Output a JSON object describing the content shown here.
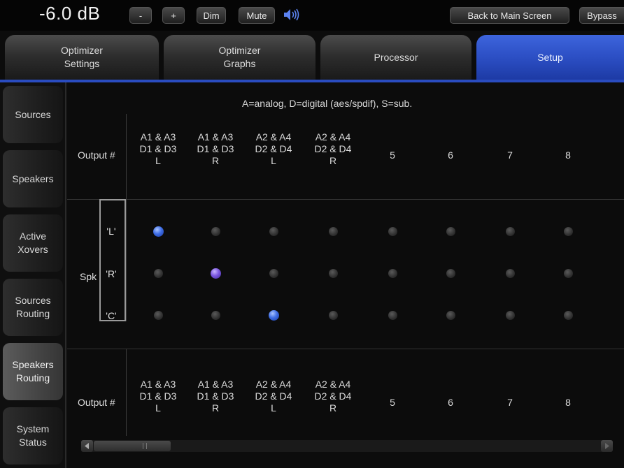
{
  "topbar": {
    "volume": "-6.0 dB",
    "minus_label": "-",
    "plus_label": "+",
    "dim_label": "Dim",
    "mute_label": "Mute",
    "back_label": "Back to Main Screen",
    "bypass_label": "Bypass"
  },
  "tabs": [
    {
      "label": "Optimizer\nSettings"
    },
    {
      "label": "Optimizer\nGraphs"
    },
    {
      "label": "Processor"
    },
    {
      "label": "Setup",
      "active": true
    }
  ],
  "sidebar": [
    {
      "label": "Sources"
    },
    {
      "label": "Speakers"
    },
    {
      "label": "Active\nXovers"
    },
    {
      "label": "Sources\nRouting"
    },
    {
      "label": "Speakers\nRouting",
      "active": true
    },
    {
      "label": "System\nStatus"
    }
  ],
  "routing": {
    "caption": "A=analog, D=digital (aes/spdif), S=sub.",
    "output_label": "Output #",
    "spk_label": "Spk",
    "columns": [
      "A1 & A3\nD1 & D3\nL",
      "A1 & A3\nD1 & D3\nR",
      "A2 & A4\nD2 & D4\nL",
      "A2 & A4\nD2 & D4\nR",
      "5",
      "6",
      "7",
      "8"
    ],
    "rows": [
      "'L'",
      "'R'",
      "'C'"
    ],
    "active": [
      [
        0,
        0,
        "blue"
      ],
      [
        1,
        1,
        "purple"
      ],
      [
        2,
        2,
        "blue"
      ]
    ]
  },
  "colors": {
    "accent": "#2c4fc4",
    "active_dot_blue": "#3f6ee6",
    "active_dot_purple": "#7a56e0"
  }
}
